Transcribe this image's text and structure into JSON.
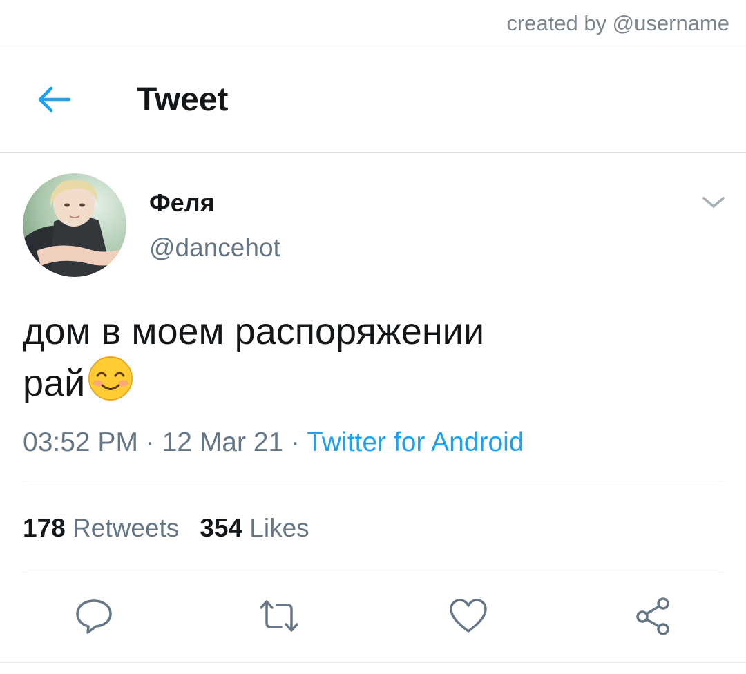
{
  "watermark": "created by @username",
  "header": {
    "title": "Tweet"
  },
  "tweet": {
    "display_name": "Феля",
    "handle": "@dancehot",
    "text_line1": "дом в моем распоряжении",
    "text_line2": "рай",
    "emoji": "smiling-face-with-blush",
    "time": "03:52 PM",
    "date": "12 Mar 21",
    "separator": " · ",
    "source": "Twitter for Android",
    "retweets_count": "178",
    "retweets_label": "Retweets",
    "likes_count": "354",
    "likes_label": "Likes"
  },
  "icons": {
    "back": "arrow-left-icon",
    "more": "chevron-down-icon",
    "reply": "reply-icon",
    "retweet": "retweet-icon",
    "like": "heart-icon",
    "share": "share-icon"
  },
  "colors": {
    "accent": "#1da1f2",
    "text_primary": "#14171a",
    "text_secondary": "#657786",
    "divider": "#e1e4e6"
  }
}
